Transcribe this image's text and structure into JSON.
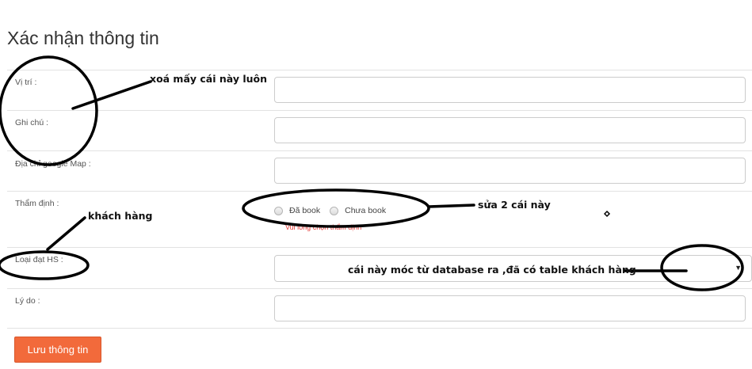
{
  "form": {
    "title": "Xác nhận thông tin",
    "fields": {
      "location_label": "Vị trí :",
      "note_label": "Ghi chú :",
      "map_address_label": "Địa chỉ google Map :",
      "appraisal_label": "Thẩm định :",
      "appraisal_options": [
        "Đã book",
        "Chưa book"
      ],
      "appraisal_validation": "Vui lòng chọn thẩm định",
      "request_type_label": "Loại đạt HS :",
      "reason_label": "Lý do :"
    },
    "save_button_label": "Lưu thông tin"
  },
  "annotations": {
    "remove_these": "xoá mấy cái này luôn",
    "customer": "khách hàng",
    "edit_these_two": "sửa 2 cái này",
    "from_database": "cái này móc từ database ra ,đã có table khách hàng"
  },
  "icons": {
    "select_arrow": "caret-down-icon"
  },
  "colors": {
    "primary_button": "#f26a3b",
    "validation": "#e53935",
    "annotation_ink": "#000000"
  }
}
